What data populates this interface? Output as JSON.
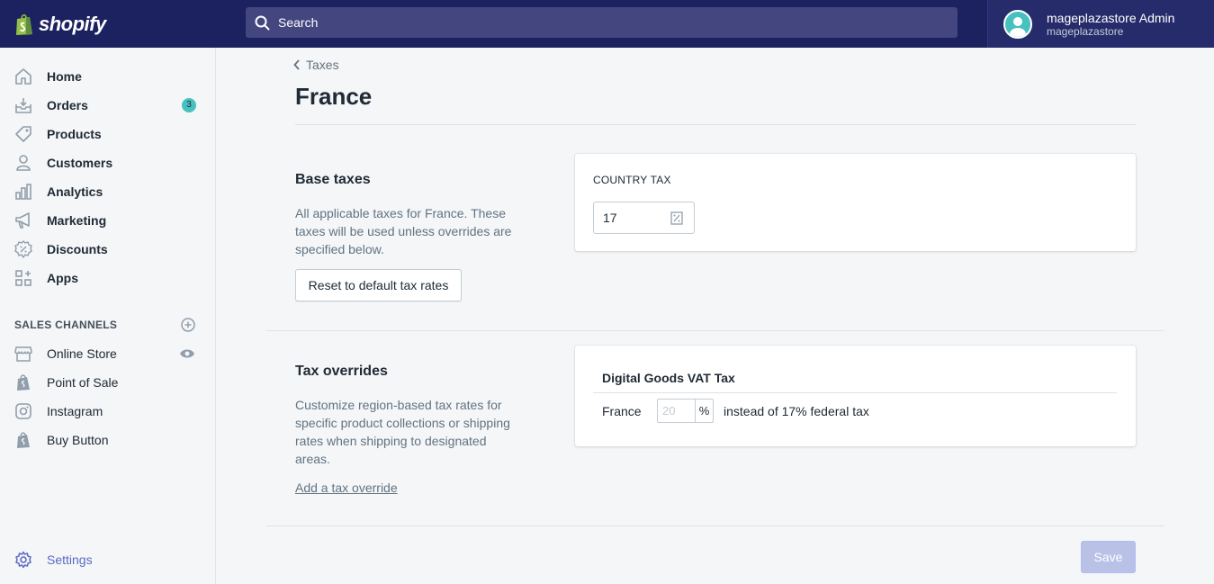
{
  "app": {
    "brand": "shopify"
  },
  "search": {
    "placeholder": "Search"
  },
  "user": {
    "name": "mageplazastore Admin",
    "store": "mageplazastore"
  },
  "sidebar": {
    "items": [
      {
        "label": "Home",
        "icon": "home-icon"
      },
      {
        "label": "Orders",
        "icon": "orders-icon",
        "badge": "3"
      },
      {
        "label": "Products",
        "icon": "tag-icon"
      },
      {
        "label": "Customers",
        "icon": "person-icon"
      },
      {
        "label": "Analytics",
        "icon": "bar-chart-icon"
      },
      {
        "label": "Marketing",
        "icon": "megaphone-icon"
      },
      {
        "label": "Discounts",
        "icon": "discount-icon"
      },
      {
        "label": "Apps",
        "icon": "apps-icon"
      }
    ],
    "sales_channels_title": "SALES CHANNELS",
    "channels": [
      {
        "label": "Online Store",
        "icon": "store-icon"
      },
      {
        "label": "Point of Sale",
        "icon": "shopping-bag-icon"
      },
      {
        "label": "Instagram",
        "icon": "instagram-icon"
      },
      {
        "label": "Buy Button",
        "icon": "shopping-bag-icon"
      }
    ],
    "settings_label": "Settings"
  },
  "page": {
    "breadcrumb": "Taxes",
    "title": "France"
  },
  "base_taxes": {
    "heading": "Base taxes",
    "description": "All applicable taxes for France. These taxes will be used unless overrides are specified below.",
    "reset_button": "Reset to default tax rates",
    "country_tax_label": "COUNTRY TAX",
    "country_tax_value": "17"
  },
  "tax_overrides": {
    "heading": "Tax overrides",
    "description": "Customize region-based tax rates for specific product collections or shipping rates when shipping to designated areas.",
    "add_link": "Add a tax override",
    "card_title": "Digital Goods VAT Tax",
    "region": "France",
    "rate_placeholder": "20",
    "percent_suffix": "%",
    "instead_text": "instead of 17% federal tax"
  },
  "footer": {
    "save_button": "Save"
  },
  "colors": {
    "topbar": "#1c2260",
    "accent": "#5c6ac4",
    "badge": "#47c1bf"
  }
}
